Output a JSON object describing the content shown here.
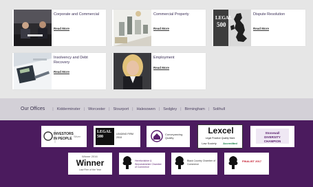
{
  "practice_areas": [
    {
      "title": "Corporate and Commercial",
      "link": "Read More",
      "icon": "business-meeting-photo"
    },
    {
      "title": "Commercial Property",
      "link": "Read More",
      "icon": "architectural-model-photo"
    },
    {
      "title": "Dispute Resolution",
      "link": "Read More",
      "icon": "uk-map-legal500-photo"
    },
    {
      "title": "Insolvency and Debt Recovery",
      "link": "Read More",
      "icon": "calculator-paperwork-photo"
    },
    {
      "title": "Employment",
      "link": "Read More",
      "icon": "businesswoman-portrait-photo"
    }
  ],
  "offices": {
    "title": "Our Offices",
    "items": [
      "Kidderminster",
      "Worcester",
      "Stourport",
      "Halesowen",
      "Sedgley",
      "Birmingham",
      "Solihull"
    ]
  },
  "accreditations": {
    "investors_in_people": {
      "line1": "INVESTORS",
      "line2": "IN PEOPLE",
      "suffix": "Silver"
    },
    "legal500": {
      "text": "LEGAL 500",
      "sub": "LEADING FIRM 2018"
    },
    "conveyancing": {
      "text": "Conveyancing Quality"
    },
    "lexcel": {
      "title": "Lexcel",
      "sub1": "Legal Practice Quality Mark",
      "sub2": "Law Society",
      "sub3": "Accredited"
    },
    "stonewall": {
      "text": "Stonewall DIVERSITY CHAMPION"
    },
    "winner": {
      "year": "Winner 2016",
      "title": "Winner",
      "sub": "Law Firm of the Year"
    },
    "chamber1": {
      "text": "Herefordshire & Worcestershire Chamber of Commerce"
    },
    "chamber2": {
      "text": "Black Country Chamber of Commerce"
    },
    "finalist": {
      "text": "FINALIST 2017"
    }
  },
  "colors": {
    "footer": "#4b1b5e",
    "title": "#3b2f57",
    "grey_bg": "#e6e6e6",
    "offices_bar": "#d3d0d7"
  }
}
